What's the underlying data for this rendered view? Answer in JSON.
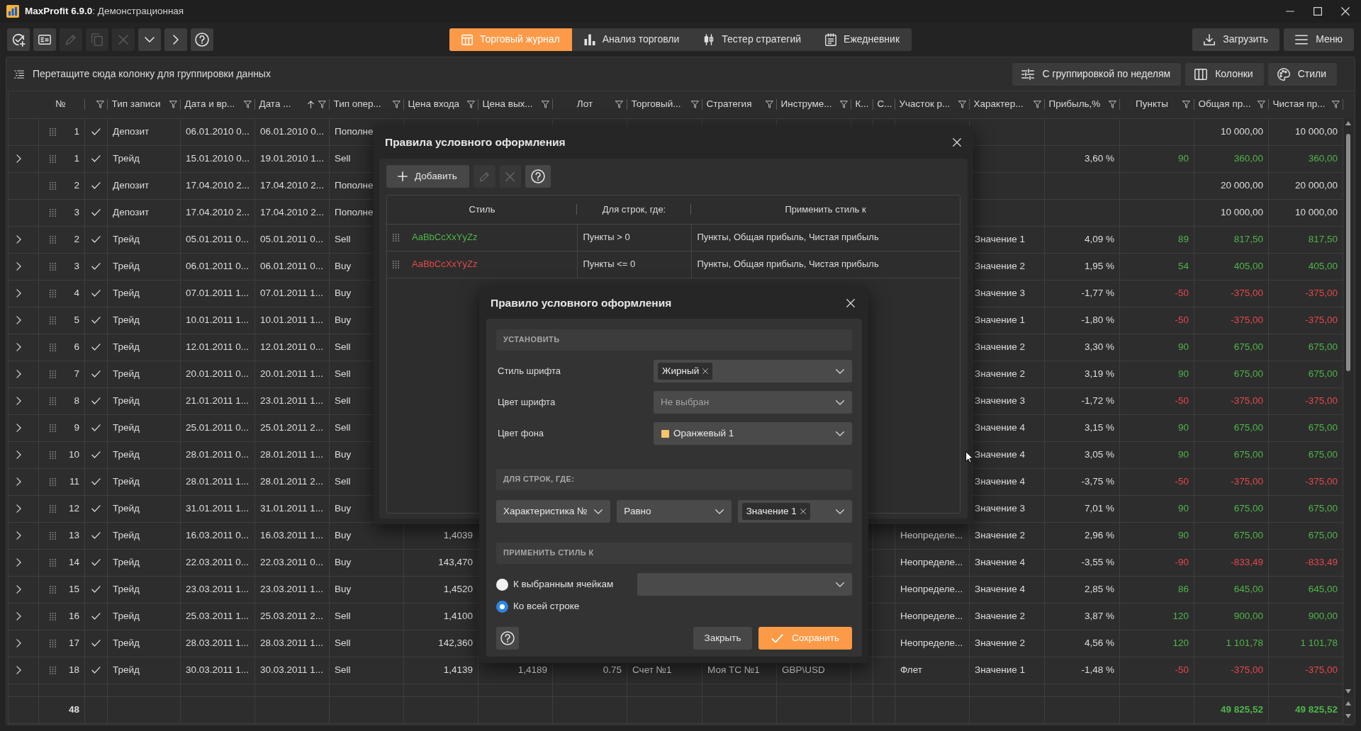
{
  "window": {
    "title": "**MaxProfit 6.9.0**: Демонстрационная"
  },
  "toolbar": {
    "tools": [
      {
        "kind": "add-check",
        "disabled": false
      },
      {
        "kind": "card",
        "disabled": false
      },
      {
        "kind": "edit",
        "disabled": true
      },
      {
        "kind": "copy",
        "disabled": true
      },
      {
        "kind": "delete",
        "disabled": true
      },
      {
        "kind": "expand",
        "disabled": false
      },
      {
        "kind": "next",
        "disabled": false
      },
      {
        "kind": "help",
        "disabled": false
      }
    ],
    "views": [
      {
        "label": "Торговый журнал",
        "kind": "journal",
        "selected": true
      },
      {
        "label": "Анализ торговли",
        "kind": "analysis",
        "selected": false
      },
      {
        "label": "Тестер стратегий",
        "kind": "tester",
        "selected": false
      },
      {
        "label": "Ежедневник",
        "kind": "diary",
        "selected": false
      }
    ],
    "actions": [
      {
        "label": "Загрузить",
        "kind": "download"
      },
      {
        "label": "Меню",
        "kind": "menu"
      }
    ]
  },
  "grouping_bar": {
    "hint": "Перетащите сюда колонку для группировки данных",
    "buttons": [
      {
        "label": "С группировкой по неделям",
        "kind": "grouping"
      },
      {
        "label": "Колонки",
        "kind": "columns"
      },
      {
        "label": "Стили",
        "kind": "styles"
      }
    ]
  },
  "table": {
    "columns": [
      {
        "label": "№",
        "filter": false,
        "sorted": false
      },
      {
        "filter": true,
        "sorted": false
      },
      {
        "label": "Тип записи",
        "filter": true,
        "sorted": false
      },
      {
        "label": "Дата и вр...",
        "filter": true,
        "sorted": false
      },
      {
        "label": "Дата ...",
        "filter": true,
        "sorted": true
      },
      {
        "label": "Тип опер...",
        "filter": true,
        "sorted": false
      },
      {
        "label": "Цена входа",
        "filter": true,
        "sorted": false
      },
      {
        "label": "Цена вых...",
        "filter": true,
        "sorted": false
      },
      {
        "label": "Лот",
        "filter": true,
        "sorted": false
      },
      {
        "label": "Торговый...",
        "filter": true,
        "sorted": false
      },
      {
        "label": "Стратегия",
        "filter": true,
        "sorted": false
      },
      {
        "label": "Инструме...",
        "filter": true,
        "sorted": false
      },
      {
        "label": "К...",
        "filter": false,
        "sorted": false
      },
      {
        "label": "С...",
        "filter": false,
        "sorted": false
      },
      {
        "label": "Участок р...",
        "filter": true,
        "sorted": false
      },
      {
        "label": "Характер...",
        "filter": true,
        "sorted": false
      },
      {
        "label": "Прибыль,%",
        "filter": true,
        "sorted": false
      },
      {
        "label": "Пункты",
        "filter": true,
        "sorted": false
      },
      {
        "label": "Общая пр...",
        "filter": true,
        "sorted": false
      },
      {
        "label": "Чистая пр...",
        "filter": true,
        "sorted": false
      }
    ],
    "rows": [
      {
        "expandable": false,
        "number": "1",
        "checked": true,
        "record_type": "Депозит",
        "opened": "06.01.2010 0...",
        "closed": "06.01.2010 0...",
        "operation": "Пополне",
        "total_profit": "10 000,00",
        "net_profit": "10 000,00"
      },
      {
        "expandable": true,
        "number": "1",
        "checked": true,
        "record_type": "Трейд",
        "opened": "15.01.2010 0...",
        "closed": "19.01.2010 1...",
        "operation": "Sell",
        "profit_pct": "3,60 %",
        "points": "90",
        "total_profit": "360,00",
        "net_profit": "360,00",
        "color": "#4fb54a"
      },
      {
        "expandable": false,
        "number": "2",
        "checked": true,
        "record_type": "Депозит",
        "opened": "17.04.2010 2...",
        "closed": "17.04.2010 2...",
        "operation": "Пополне",
        "total_profit": "20 000,00",
        "net_profit": "20 000,00"
      },
      {
        "expandable": false,
        "number": "3",
        "checked": true,
        "record_type": "Депозит",
        "opened": "17.04.2010 2...",
        "closed": "17.04.2010 2...",
        "operation": "Пополне",
        "total_profit": "10 000,00",
        "net_profit": "10 000,00"
      },
      {
        "expandable": true,
        "number": "2",
        "checked": true,
        "record_type": "Трейд",
        "opened": "05.01.2011 0...",
        "closed": "05.01.2011 0...",
        "operation": "Sell",
        "characteristic": "Значение 1",
        "profit_pct": "4,09 %",
        "points": "89",
        "total_profit": "817,50",
        "net_profit": "817,50",
        "color": "#4fb54a"
      },
      {
        "expandable": true,
        "number": "3",
        "checked": true,
        "record_type": "Трейд",
        "opened": "06.01.2011 0...",
        "closed": "06.01.2011 0...",
        "operation": "Buy",
        "characteristic": "Значение 2",
        "profit_pct": "1,95 %",
        "points": "54",
        "total_profit": "405,00",
        "net_profit": "405,00",
        "color": "#4fb54a"
      },
      {
        "expandable": true,
        "number": "4",
        "checked": true,
        "record_type": "Трейд",
        "opened": "07.01.2011 1...",
        "closed": "07.01.2011 1...",
        "operation": "Buy",
        "characteristic": "Значение 3",
        "profit_pct": "-1,77 %",
        "points": "-50",
        "total_profit": "-375,00",
        "net_profit": "-375,00",
        "color": "#e5484b"
      },
      {
        "expandable": true,
        "number": "5",
        "checked": true,
        "record_type": "Трейд",
        "opened": "10.01.2011 1...",
        "closed": "10.01.2011 1...",
        "operation": "Buy",
        "characteristic": "Значение 1",
        "profit_pct": "-1,80 %",
        "points": "-50",
        "total_profit": "-375,00",
        "net_profit": "-375,00",
        "color": "#e5484b"
      },
      {
        "expandable": true,
        "number": "6",
        "checked": true,
        "record_type": "Трейд",
        "opened": "12.01.2011 0...",
        "closed": "12.01.2011 0...",
        "operation": "Sell",
        "characteristic": "Значение 2",
        "profit_pct": "3,30 %",
        "points": "90",
        "total_profit": "675,00",
        "net_profit": "675,00",
        "color": "#4fb54a"
      },
      {
        "expandable": true,
        "number": "7",
        "checked": true,
        "record_type": "Трейд",
        "opened": "20.01.2011 0...",
        "closed": "20.01.2011 1...",
        "operation": "Sell",
        "characteristic": "Значение 2",
        "profit_pct": "3,19 %",
        "points": "90",
        "total_profit": "675,00",
        "net_profit": "675,00",
        "color": "#4fb54a"
      },
      {
        "expandable": true,
        "number": "8",
        "checked": true,
        "record_type": "Трейд",
        "opened": "21.01.2011 1...",
        "closed": "23.01.2011 1...",
        "operation": "Sell",
        "characteristic": "Значение 3",
        "profit_pct": "-1,72 %",
        "points": "-50",
        "total_profit": "-375,00",
        "net_profit": "-375,00",
        "color": "#e5484b"
      },
      {
        "expandable": true,
        "number": "9",
        "checked": true,
        "record_type": "Трейд",
        "opened": "25.01.2011 0...",
        "closed": "25.01.2011 2...",
        "operation": "Sell",
        "characteristic": "Значение 4",
        "profit_pct": "3,15 %",
        "points": "90",
        "total_profit": "675,00",
        "net_profit": "675,00",
        "color": "#4fb54a"
      },
      {
        "expandable": true,
        "number": "10",
        "checked": true,
        "record_type": "Трейд",
        "opened": "28.01.2011 0...",
        "closed": "28.01.2011 1...",
        "operation": "Buy",
        "characteristic": "Значение 4",
        "profit_pct": "3,05 %",
        "points": "90",
        "total_profit": "675,00",
        "net_profit": "675,00",
        "color": "#4fb54a"
      },
      {
        "expandable": true,
        "number": "11",
        "checked": true,
        "record_type": "Трейд",
        "opened": "28.01.2011 1...",
        "closed": "28.01.2011 2...",
        "operation": "Sell",
        "characteristic": "Значение 4",
        "profit_pct": "-3,75 %",
        "points": "-50",
        "total_profit": "-375,00",
        "net_profit": "-375,00",
        "color": "#e5484b"
      },
      {
        "expandable": true,
        "number": "12",
        "checked": true,
        "record_type": "Трейд",
        "opened": "31.01.2011 1...",
        "closed": "31.01.2011 1...",
        "operation": "Buy",
        "characteristic": "Значение 3",
        "profit_pct": "7,01 %",
        "points": "90",
        "total_profit": "675,00",
        "net_profit": "675,00",
        "color": "#4fb54a"
      },
      {
        "expandable": true,
        "number": "13",
        "checked": true,
        "record_type": "Трейд",
        "opened": "16.03.2011 0...",
        "closed": "16.03.2011 1...",
        "operation": "Buy",
        "entry_price": "1,4039",
        "segment": "Неопределе...",
        "characteristic": "Значение 2",
        "profit_pct": "2,96 %",
        "points": "90",
        "total_profit": "675,00",
        "net_profit": "675,00",
        "color": "#4fb54a"
      },
      {
        "expandable": true,
        "number": "14",
        "checked": true,
        "record_type": "Трейд",
        "opened": "22.03.2011 0...",
        "closed": "22.03.2011 0...",
        "operation": "Buy",
        "entry_price": "143,470",
        "segment": "Неопределе...",
        "characteristic": "Значение 4",
        "profit_pct": "-3,55 %",
        "points": "-90",
        "total_profit": "-833,49",
        "net_profit": "-833,49",
        "color": "#e5484b"
      },
      {
        "expandable": true,
        "number": "15",
        "checked": true,
        "record_type": "Трейд",
        "opened": "23.03.2011 1...",
        "closed": "23.03.2011 1...",
        "operation": "Buy",
        "entry_price": "1,4520",
        "segment": "Неопределе...",
        "characteristic": "Значение 4",
        "profit_pct": "2,85 %",
        "points": "86",
        "total_profit": "645,00",
        "net_profit": "645,00",
        "color": "#4fb54a"
      },
      {
        "expandable": true,
        "number": "16",
        "checked": true,
        "record_type": "Трейд",
        "opened": "25.03.2011 1...",
        "closed": "25.03.2011 2...",
        "operation": "Sell",
        "entry_price": "1,4100",
        "segment": "Неопределе...",
        "characteristic": "Значение 2",
        "profit_pct": "3,87 %",
        "points": "120",
        "total_profit": "900,00",
        "net_profit": "900,00",
        "color": "#4fb54a"
      },
      {
        "expandable": true,
        "number": "17",
        "checked": true,
        "record_type": "Трейд",
        "opened": "28.03.2011 1...",
        "closed": "28.03.2011 1...",
        "operation": "Sell",
        "entry_price": "142,360",
        "segment": "Неопределе...",
        "characteristic": "Значение 2",
        "profit_pct": "4,56 %",
        "points": "120",
        "total_profit": "1 101,78",
        "net_profit": "1 101,78",
        "color": "#4fb54a"
      },
      {
        "expandable": true,
        "number": "18",
        "checked": true,
        "record_type": "Трейд",
        "opened": "30.03.2011 1...",
        "closed": "30.03.2011 1...",
        "operation": "Sell",
        "entry_price": "1,4139",
        "exit_price": "1,4189",
        "lot": "0.75",
        "account": "Счет №1",
        "strategy": "Моя ТС №1",
        "instrument": "GBP\\USD",
        "segment": "Флет",
        "characteristic": "Значение 1",
        "profit_pct": "-1,48 %",
        "points": "-50",
        "total_profit": "-375,00",
        "net_profit": "-375,00",
        "color": "#e5484b"
      }
    ],
    "footer": {
      "count": "48",
      "total_profit": "49 825,52",
      "net_profit": "49 825,52",
      "color": "#4fb54a"
    }
  },
  "rules_dialog": {
    "title": "Правила условного оформления",
    "toolbar": [
      {
        "kind": "add",
        "label": "Добавить",
        "disabled": false
      },
      {
        "kind": "edit",
        "disabled": true
      },
      {
        "kind": "delete",
        "disabled": true
      },
      {
        "kind": "help",
        "disabled": false
      }
    ],
    "columns": [
      "Стиль",
      "Для строк, где:",
      "Применить стиль к"
    ],
    "rules": [
      {
        "sample": "AaBbCcXxYyZz",
        "color": "#4fb54a",
        "condition": "Пункты > 0",
        "apply_to": "Пункты, Общая прибыль, Чистая прибыль"
      },
      {
        "sample": "AaBbCcXxYyZz",
        "color": "#e5484b",
        "condition": "Пункты <= 0",
        "apply_to": "Пункты, Общая прибыль, Чистая прибыль"
      }
    ]
  },
  "rule_dialog": {
    "title": "Правило условного оформления",
    "style_section": {
      "heading": "УСТАНОВИТЬ",
      "fields": [
        {
          "label": "Стиль шрифта",
          "kind": "tags",
          "tags": [
            "Жирный"
          ]
        },
        {
          "label": "Цвет шрифта",
          "kind": "select",
          "placeholder": "Не выбран"
        },
        {
          "label": "Цвет фона",
          "kind": "color",
          "value": "Оранжевый 1",
          "color": "#f8c56b"
        }
      ]
    },
    "condition_section": {
      "heading": "ДЛЯ СТРОК, ГДЕ:",
      "selects": [
        {
          "kind": "select",
          "value": "Характеристика №"
        },
        {
          "kind": "select",
          "value": "Равно"
        },
        {
          "kind": "tags",
          "tags": [
            "Значение 1"
          ]
        }
      ]
    },
    "apply_section": {
      "heading": "ПРИМЕНИТЬ СТИЛЬ К",
      "options": [
        {
          "label": "К выбранным ячейкам",
          "selected": false
        },
        {
          "label": "Ко всей строке",
          "selected": true
        }
      ]
    },
    "buttons": [
      {
        "label": "Закрыть",
        "kind": "secondary"
      },
      {
        "label": "Сохранить",
        "kind": "primary"
      }
    ]
  }
}
